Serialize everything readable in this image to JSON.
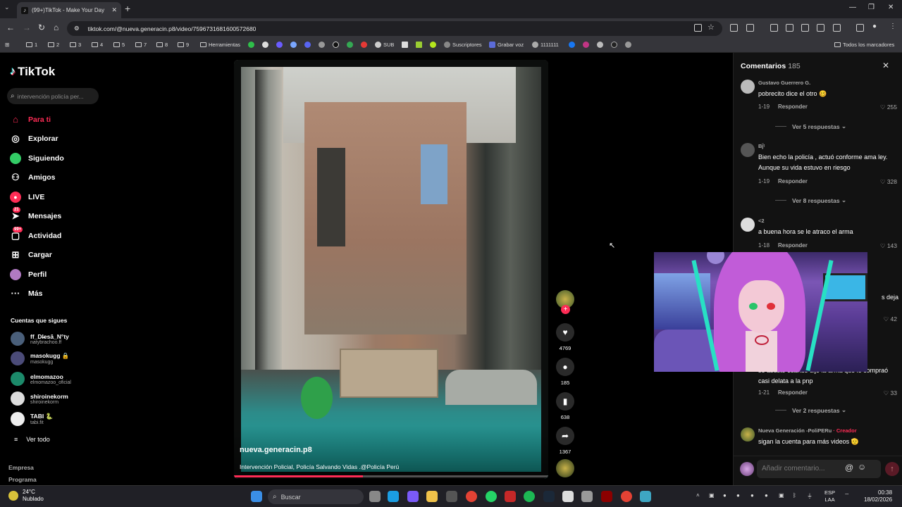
{
  "browser": {
    "tab_title": "(99+)TikTok - Make Your Day",
    "tab_close": "✕",
    "new_tab": "+",
    "url": "tiktok.com/@nueva.generacin.p8/video/7596731681600572680",
    "window_controls": {
      "minimize": "—",
      "maximize": "❐",
      "close": "✕"
    }
  },
  "bookmarks": [
    {
      "label": "1",
      "type": "folder"
    },
    {
      "label": "2",
      "type": "folder"
    },
    {
      "label": "3",
      "type": "folder"
    },
    {
      "label": "4",
      "type": "folder"
    },
    {
      "label": "5",
      "type": "folder"
    },
    {
      "label": "7",
      "type": "folder"
    },
    {
      "label": "8",
      "type": "folder"
    },
    {
      "label": "9",
      "type": "folder"
    },
    {
      "label": "Herramientas",
      "type": "folder"
    },
    {
      "label": "SUB",
      "type": "link"
    },
    {
      "label": "Suscriptores",
      "type": "link"
    },
    {
      "label": "Grabar voz",
      "type": "link"
    },
    {
      "label": "1111111",
      "type": "link"
    },
    {
      "label": "Todos los marcadores",
      "type": "folder"
    }
  ],
  "sidebar": {
    "logo": "TikTok",
    "search_placeholder": "intervención policía per...",
    "nav": [
      {
        "label": "Para ti",
        "icon": "home-icon",
        "active": true
      },
      {
        "label": "Explorar",
        "icon": "compass-icon"
      },
      {
        "label": "Siguiendo",
        "icon": "following-icon"
      },
      {
        "label": "Amigos",
        "icon": "friends-icon"
      },
      {
        "label": "LIVE",
        "icon": "live-icon"
      },
      {
        "label": "Mensajes",
        "icon": "messages-icon",
        "badge": "21"
      },
      {
        "label": "Actividad",
        "icon": "activity-icon",
        "badge": "99+"
      },
      {
        "label": "Cargar",
        "icon": "upload-icon"
      },
      {
        "label": "Perfil",
        "icon": "profile-icon"
      },
      {
        "label": "Más",
        "icon": "more-icon"
      }
    ],
    "following_title": "Cuentas que sigues",
    "following": [
      {
        "name": "ff_Dl̶esā_N°ty",
        "handle": "natybrachoo.ff"
      },
      {
        "name": "masokugg 🔒",
        "handle": "masokugg"
      },
      {
        "name": "elmomazoo",
        "handle": "elmomazoo_oficial"
      },
      {
        "name": "shiroinekorm",
        "handle": "shiroinekorm"
      },
      {
        "name": "TABI 🐍",
        "handle": "tabi.fit"
      }
    ],
    "see_all": "Ver todo",
    "footer": [
      "Empresa",
      "Programa"
    ]
  },
  "video": {
    "username": "nueva.generacin.p8",
    "caption": "Intervención Policial, Policía Salvando Vidas .@Policía Perú",
    "progress": 0.41,
    "likes": "4769",
    "comments": "185",
    "saves": "638",
    "shares": "1367"
  },
  "comments_panel": {
    "title": "Comentarios",
    "count": "185",
    "reply_label": "Responder",
    "items": [
      {
        "user": "Gustavo Guerrero G.",
        "text": "pobrecito dice el otro 🥴",
        "date": "1-19",
        "likes": "255",
        "more": "Ver 5 respuestas"
      },
      {
        "user": "Bj̈ᵗ",
        "text": "Bien echo la policía , actuó conforme ama ley. Aunque su vida estuvo en riesgo",
        "date": "1-19",
        "likes": "328",
        "more": "Ver 8 respuestas"
      },
      {
        "user": "<2",
        "text": "a buena hora se le atraco el arma",
        "date": "1-18",
        "likes": "143",
        "more": ""
      },
      {
        "user": "",
        "text": "s deja",
        "date": "",
        "likes": "42",
        "more": ""
      },
      {
        "user": "",
        "text": "se asustó cuando dijo la arma que le compraó casi delata a la pnp",
        "date": "1-21",
        "likes": "33",
        "more": "Ver 2 respuestas"
      },
      {
        "user": "Nueva Generación -PoliPERu",
        "creator_tag": "· Creador",
        "text": "sigan la cuenta para más videos 🫡",
        "date": "",
        "likes": "",
        "more": ""
      }
    ],
    "input_placeholder": "Añadir comentario..."
  },
  "taskbar": {
    "weather_temp": "24°C",
    "weather_desc": "Nublado",
    "search": "Buscar",
    "lang_top": "ESP",
    "lang_bottom": "LAA",
    "time": "00:38",
    "date": "18/02/2026"
  },
  "colors": {
    "accent": "#fe2c55",
    "bg": "#000000",
    "panel": "#121212"
  }
}
